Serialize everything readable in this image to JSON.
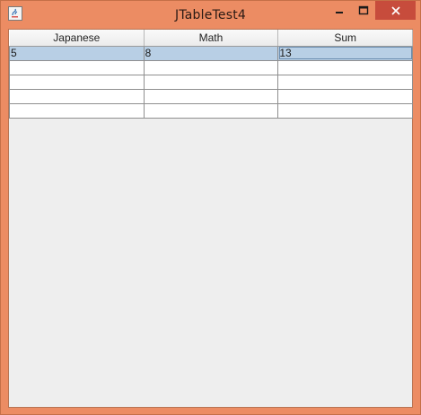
{
  "window": {
    "title": "JTableTest4",
    "controls": {
      "minimize": "minimize",
      "maximize": "maximize",
      "close": "close"
    }
  },
  "table": {
    "columns": [
      "Japanese",
      "Math",
      "Sum"
    ],
    "rows": [
      [
        "5",
        "8",
        "13"
      ],
      [
        "",
        "",
        ""
      ],
      [
        "",
        "",
        ""
      ],
      [
        "",
        "",
        ""
      ],
      [
        "",
        "",
        ""
      ]
    ],
    "selected_row": 0
  },
  "colors": {
    "titlebar": "#ec8c63",
    "close_button": "#c74c3c",
    "selection": "#b8cfe5",
    "panel": "#eeeeee"
  }
}
